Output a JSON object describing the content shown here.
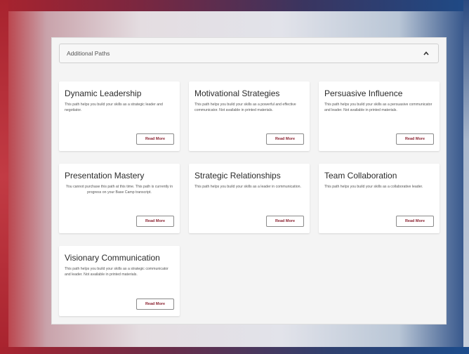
{
  "accordion": {
    "title": "Additional Paths",
    "toggle_icon": "chevron-up-icon"
  },
  "cards": [
    {
      "title": "Dynamic Leadership",
      "description": "This path helps you build your skills as a strategic leader and negotiator.",
      "button_label": "Read More"
    },
    {
      "title": "Motivational Strategies",
      "description": "This path helps you build your skills as a powerful and effective communicator. Not available in printed materials.",
      "button_label": "Read More"
    },
    {
      "title": "Persuasive Influence",
      "description": "This path helps you build your skills as a persuasive communicator and leader. Not available in printed materials.",
      "button_label": "Read More"
    },
    {
      "title": "Presentation Mastery",
      "description": "You cannot purchase this path at this time. This path is currently in progress on your Base Camp transcript.",
      "button_label": "Read More"
    },
    {
      "title": "Strategic Relationships",
      "description": "This path helps you build your skills as a leader in communication.",
      "button_label": "Read More"
    },
    {
      "title": "Team Collaboration",
      "description": "This path helps you build your skills as a collaborative leader.",
      "button_label": "Read More"
    },
    {
      "title": "Visionary Communication",
      "description": "This path helps you build your skills as a strategic communicator and leader. Not available in printed materials.",
      "button_label": "Read More"
    }
  ]
}
